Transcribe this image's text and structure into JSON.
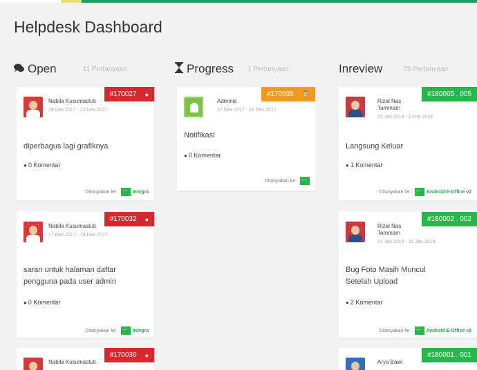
{
  "page": {
    "title": "Helpdesk Dashboard"
  },
  "columns": [
    {
      "name": "Open",
      "count": "11 Pertanyaan",
      "icon": "comments-icon"
    },
    {
      "name": "Progress",
      "count": "1 Pertanyaan",
      "icon": "hourglass-icon"
    },
    {
      "name": "Inreview",
      "count": "25 Pertanyaan",
      "icon": "none"
    }
  ],
  "cards": {
    "c1": {
      "badge": "#170027",
      "author": "Nabila Kusumastuti",
      "date": "16 Des 2017 - 23 Des 2017",
      "title": "diperbagus lagi grafiknya",
      "comments": "0 Komentar",
      "asked_label": "Ditanyakan ke :",
      "target": "Integra"
    },
    "c2": {
      "badge": "#170032",
      "author": "Nabila Kusumastuti",
      "date": "17 Des 2017 - 24 Des 2017",
      "title_line1": "saran untuk halaman daftar",
      "title_line2": "pengguna pada user admin",
      "comments": "0 Komentar",
      "asked_label": "Ditanyakan ke :",
      "target": "Integra"
    },
    "c3": {
      "badge": "#170030",
      "author": "Nabila Kusumastuti"
    },
    "p1": {
      "badge": "#170035",
      "author": "Adminis",
      "date": "17 Des 2017 - 24 Des 2017",
      "title": "Notifikasi",
      "comments": "0 Komentar",
      "asked_label": "Ditanyakan ke :"
    },
    "r1": {
      "badge": "#180005 . 005",
      "author": "Rizal Nas",
      "author2": "Tammam",
      "date": "20 Jan 2018 - 2 Feb 2018",
      "title": "Langsung Keluar",
      "comments": "1 Komentar",
      "asked_label": "Ditanyakan ke :",
      "target": "Android E-Office v2"
    },
    "r2": {
      "badge": "#180002 . 002",
      "author": "Rizal Nas",
      "author2": "Tammam",
      "date": "24 Jan 2018 - 31 Jan 2018",
      "title_line1": "Bug Foto Masih Muncul",
      "title_line2": "Setelah Upload",
      "comments": "2 Komentar",
      "asked_label": "Ditanyakan ke :",
      "target": "Android E-Office v2"
    },
    "r3": {
      "badge": "#180001 . 001",
      "author": "Arya Bawi"
    }
  },
  "colors": {
    "accent_green": "#27b64c",
    "badge_red": "#d9262f",
    "badge_orange": "#f19a1d"
  }
}
